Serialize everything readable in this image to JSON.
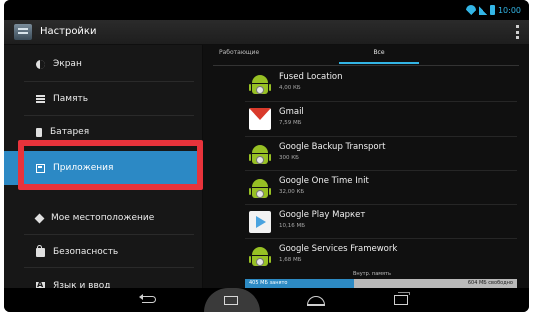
{
  "status_bar": {
    "time": "10:00"
  },
  "action_bar": {
    "title": "Настройки"
  },
  "sidebar": {
    "items": [
      {
        "label": "Экран",
        "icon": "display-icon"
      },
      {
        "label": "Память",
        "icon": "memory-icon"
      },
      {
        "label": "Батарея",
        "icon": "battery-icon"
      },
      {
        "label": "Приложения",
        "icon": "apps-icon",
        "active": true
      },
      {
        "label": "Мое местоположение",
        "icon": "location-icon"
      },
      {
        "label": "Безопасность",
        "icon": "lock-icon"
      },
      {
        "label": "Язык и ввод",
        "icon": "language-icon"
      }
    ]
  },
  "tabs": [
    {
      "label": "Работающие"
    },
    {
      "label": "Все",
      "selected": true
    }
  ],
  "apps": [
    {
      "name": "Fused Location",
      "size": "4,00 КБ",
      "icon": "android-icon"
    },
    {
      "name": "Gmail",
      "size": "7,59 МБ",
      "icon": "gmail-icon"
    },
    {
      "name": "Google Backup Transport",
      "size": "300 КБ",
      "icon": "android-icon"
    },
    {
      "name": "Google One Time Init",
      "size": "32,00 КБ",
      "icon": "android-icon"
    },
    {
      "name": "Google Play Маркет",
      "size": "10,16 МБ",
      "icon": "play-store-icon"
    },
    {
      "name": "Google Services Framework",
      "size": "1,68 МБ",
      "icon": "android-icon"
    }
  ],
  "storage": {
    "label": "Внутр. память",
    "used": "405 МБ занято",
    "free": "604 МБ свободно",
    "used_fraction": 0.4
  },
  "colors": {
    "accent": "#33b5e5",
    "active_item": "#2c89c5",
    "highlight_frame": "#e8333b"
  }
}
